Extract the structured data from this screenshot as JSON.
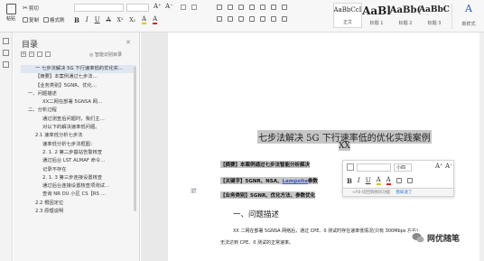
{
  "toolbar": {
    "paste": "粘贴",
    "cut": "剪切",
    "copy": "复制",
    "format_painter": "格式刷",
    "font_size_glyphs": [
      "A⁺",
      "A⁻"
    ],
    "format_glyphs": [
      "B",
      "I",
      "U",
      "A",
      "X²",
      "X₂",
      "A",
      "A"
    ],
    "styles": [
      {
        "preview": "AaBbCcI",
        "name": "正文"
      },
      {
        "preview": "AaBl",
        "name": "标题 1"
      },
      {
        "preview": "AaBb(",
        "name": "标题 2"
      },
      {
        "preview": "AaBbC",
        "name": "标题 3"
      }
    ],
    "new_style": "新样式"
  },
  "toc": {
    "title": "目录",
    "smart_label": "智能识别目录",
    "items": [
      "一 七步法解决 5G 下行速率低的优化实…",
      "【摘要】本案例通过七步法…",
      "【业务类别】5GNR、优化…",
      "一、问题描述",
      "XX二网在部署 5GNSA 网…",
      "二、分析过程",
      "通过测查后问题时，我们主…",
      "对以下的解决速率低问题。",
      "2.1 速率低分析七步法",
      "速率低分析七步法框图：",
      "2. 1. 2 第二步基站告警核查",
      "通过后台 LST ALMAF 命令…",
      "记录不存在",
      "2. 1. 3 第三步连接设置核查",
      "通过后台连接设置核查项测试…",
      "查询 NR DU 小区 CS【RS …",
      "2.2 根因定位",
      "2.3 原理说明"
    ],
    "selected_index": 0
  },
  "document": {
    "title": "七步法解决 5G 下行速率低的优化实践案例",
    "author": "XX",
    "abstract_prefix": "【摘要】本案例通过七步法智能分析解决",
    "keywords_prefix": "【关键字】5GNR、NSA、",
    "keywords_link": "Lampsite",
    "keywords_suffix": "参数",
    "category": "【业务类别】5GNR、优化方法、参数优化",
    "heading1": "一、问题描述",
    "body1": "XX 二网在部署 5GNSA 网络后，通过 CPE、0 测试时存在速率低情况(只有 300Mbps 左右)，",
    "body2": "无法达到 CPE、0 测试的正常速率。"
  },
  "float_toolbar": {
    "font_size": "小四",
    "hint": "<F6-切回到顾问功能",
    "link": "我知道了"
  },
  "watermark": "网优随笔"
}
